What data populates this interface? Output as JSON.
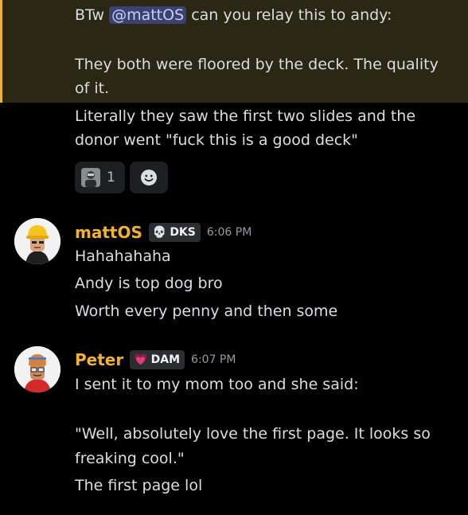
{
  "previous_message": {
    "lines": [
      {
        "prefix": "BTw ",
        "mention": "@mattOS",
        "suffix": " can you relay this to andy:"
      },
      {
        "text": "They both were floored by the deck. The quality"
      },
      {
        "text": "of it."
      },
      {
        "text": "Literally they saw the first two slides and the"
      },
      {
        "text": "donor went \"fuck this is a good deck\""
      }
    ],
    "reactions": [
      {
        "emoji": "custom-avatar-emoji",
        "count": "1"
      }
    ],
    "add_reaction_icon": "smile-plus-icon"
  },
  "messages": [
    {
      "username": "mattOS",
      "tag": {
        "icon": "💀",
        "label": "DKS"
      },
      "timestamp": "6:06 PM",
      "lines": [
        "Hahahahaha",
        "Andy is top dog bro",
        "Worth every penny and then some"
      ],
      "name_color": "#f0b232"
    },
    {
      "username": "Peter",
      "tag": {
        "icon": "💗",
        "label": "DAM"
      },
      "timestamp": "6:07 PM",
      "lines": [
        "I sent it to my mom too and she said:",
        "",
        "\"Well, absolutely love the first page. It looks so",
        "freaking cool.\"",
        "The first page lol"
      ],
      "name_color": "#f0b232"
    }
  ],
  "colors": {
    "background": "#000000",
    "highlight_background": "#2a2715",
    "highlight_border": "#f0b232",
    "text": "#dbdee1",
    "mention_bg": "#3c4270",
    "timestamp": "#949ba4"
  }
}
